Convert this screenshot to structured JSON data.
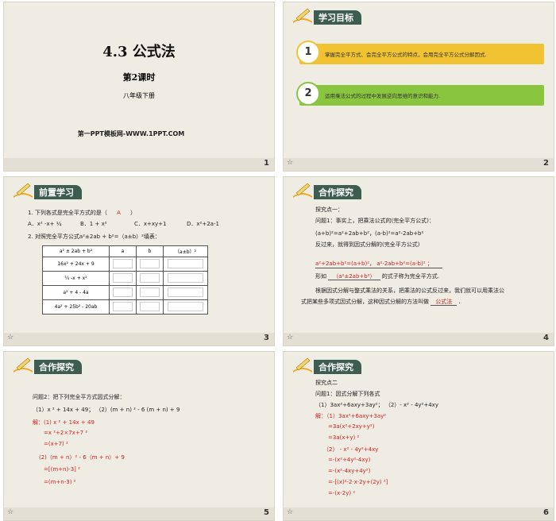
{
  "slides": [
    {
      "num": "1",
      "title": "4.3   公式法",
      "subtitle": "第2课时",
      "grade": "八年级下册",
      "site": "第一PPT模板网-WWW.1PPT.COM"
    },
    {
      "num": "2",
      "header": "学习目标",
      "goals": [
        {
          "n": "1",
          "text": "掌握完全平方式、会完全平方公式的特点，会用完全平方公式分解因式."
        },
        {
          "n": "2",
          "text": "运用乘法公式的过程中发展逆向思维的意识和能力."
        }
      ]
    },
    {
      "num": "3",
      "header": "前置学习",
      "q1": "1. 下列各式是完全平方式的是（",
      "q1ans": "A",
      "q1end": "）",
      "opts": [
        "A．x² -x+ ¼",
        "B．1 + x²",
        "C．x+xy+1",
        "D．x²+2a-1"
      ],
      "q2": "2. 对照完全平方公式a²±2ab + b²=（a±b）²填表：",
      "table_head": [
        "a² ± 2ab + b²",
        "a",
        "b",
        "（a±b）²"
      ],
      "table_rows": [
        "16x² + 24x + 9",
        "¼ -x + x²",
        "a² + 4 - 4a",
        "4a² + 25b² - 20ab"
      ]
    },
    {
      "num": "4",
      "header": "合作探究",
      "lines": [
        {
          "t": "探究点一：",
          "c": ""
        },
        {
          "t": "问题1：事实上，把乘法公式的(完全平方公式)：",
          "c": ""
        },
        {
          "t": "(a+b)²=a²+2ab+b²，(a-b)²=a²-2ab+b²",
          "c": ""
        },
        {
          "t": "反过来，就得到因式分解的(完全平方公式)",
          "c": ""
        },
        {
          "t": "a²+2ab+b²=(a+b)²，   a²-2ab+b²=(a-b)²   ；",
          "c": "red"
        },
        {
          "t": "形如",
          "c": ""
        },
        {
          "t": "根据因式分解与整式乘法的关系，把乘法的公式反过来，我们就可以用乘法公",
          "c": ""
        },
        {
          "t": "式把某些多项式因式分解，这种因式分解的方法叫做",
          "c": ""
        }
      ],
      "form": "（a²±2ab+b²）",
      "form_end": "的式子称为完全平方式.",
      "method": "公式法",
      "period": "."
    },
    {
      "num": "5",
      "header": "合作探究",
      "lines": [
        {
          "t": "问题2：把下列完全平方式因式分解：",
          "c": ""
        },
        {
          "t": "（1）x ² + 14x + 49；              （2）(m + n) ² - 6 (m + n) + 9",
          "c": ""
        },
        {
          "t": "解：(1) x ² + 14x + 49",
          "c": "red"
        },
        {
          "t": "=x ²+2×7x+7 ²",
          "c": "red"
        },
        {
          "t": "=(x+7) ²",
          "c": "red"
        },
        {
          "t": "(2)（m + n）² - 6（m + n）+ 9",
          "c": "red"
        },
        {
          "t": "=[(m+n)-3] ²",
          "c": "red"
        },
        {
          "t": "=(m+n-3) ²",
          "c": "red"
        }
      ]
    },
    {
      "num": "6",
      "header": "合作探究",
      "lines": [
        {
          "t": "探究点二",
          "c": ""
        },
        {
          "t": "问题1：因式分解下列各式",
          "c": ""
        },
        {
          "t": "（1）3ax²+6axy+3ay²；        （2）- x² - 4y²+4xy",
          "c": ""
        },
        {
          "t": "解：（1）3ax²+6axy+3ay²",
          "c": "red"
        },
        {
          "t": "=3a(x²+2xy+y²)",
          "c": "red"
        },
        {
          "t": "=3a(x+y) ²",
          "c": "red"
        },
        {
          "t": "（2） - x² - 4y²+4xy",
          "c": "red"
        },
        {
          "t": "=-(x²+4y²-4xy)",
          "c": "red"
        },
        {
          "t": "=-(x²-4xy+4y²)",
          "c": "red"
        },
        {
          "t": "=-[(x)²-2·x·2y+(2y) ²]",
          "c": "red"
        },
        {
          "t": "=-(x-2y) ²",
          "c": "red"
        }
      ]
    }
  ],
  "star": "☆"
}
